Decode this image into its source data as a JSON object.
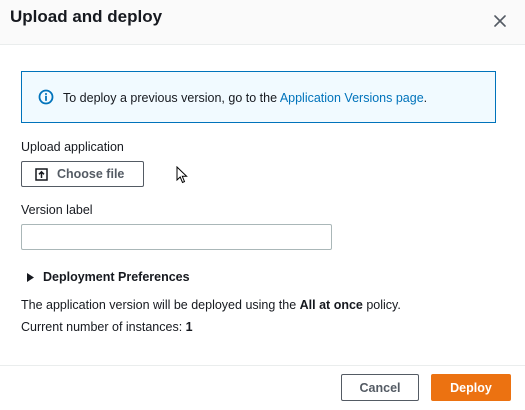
{
  "dialog": {
    "title": "Upload and deploy",
    "close_icon": "close-icon"
  },
  "info": {
    "icon": "info-icon",
    "text": "To deploy a previous version, go to the ",
    "link": "Application Versions page",
    "suffix": "."
  },
  "upload": {
    "label": "Upload application",
    "button_icon": "upload-icon",
    "button_label": "Choose file"
  },
  "version": {
    "label": "Version label",
    "value": ""
  },
  "preferences": {
    "icon": "caret-right-icon",
    "label": "Deployment Preferences"
  },
  "policy": {
    "prefix": "The application version will be deployed using the ",
    "policy_name": "All at once",
    "suffix": " policy."
  },
  "instances": {
    "label": "Current number of instances: ",
    "count": "1"
  },
  "footer": {
    "cancel_label": "Cancel",
    "deploy_label": "Deploy"
  },
  "colors": {
    "accent": "#ec7211",
    "link": "#0073bb",
    "info_bg": "#f1faff"
  }
}
